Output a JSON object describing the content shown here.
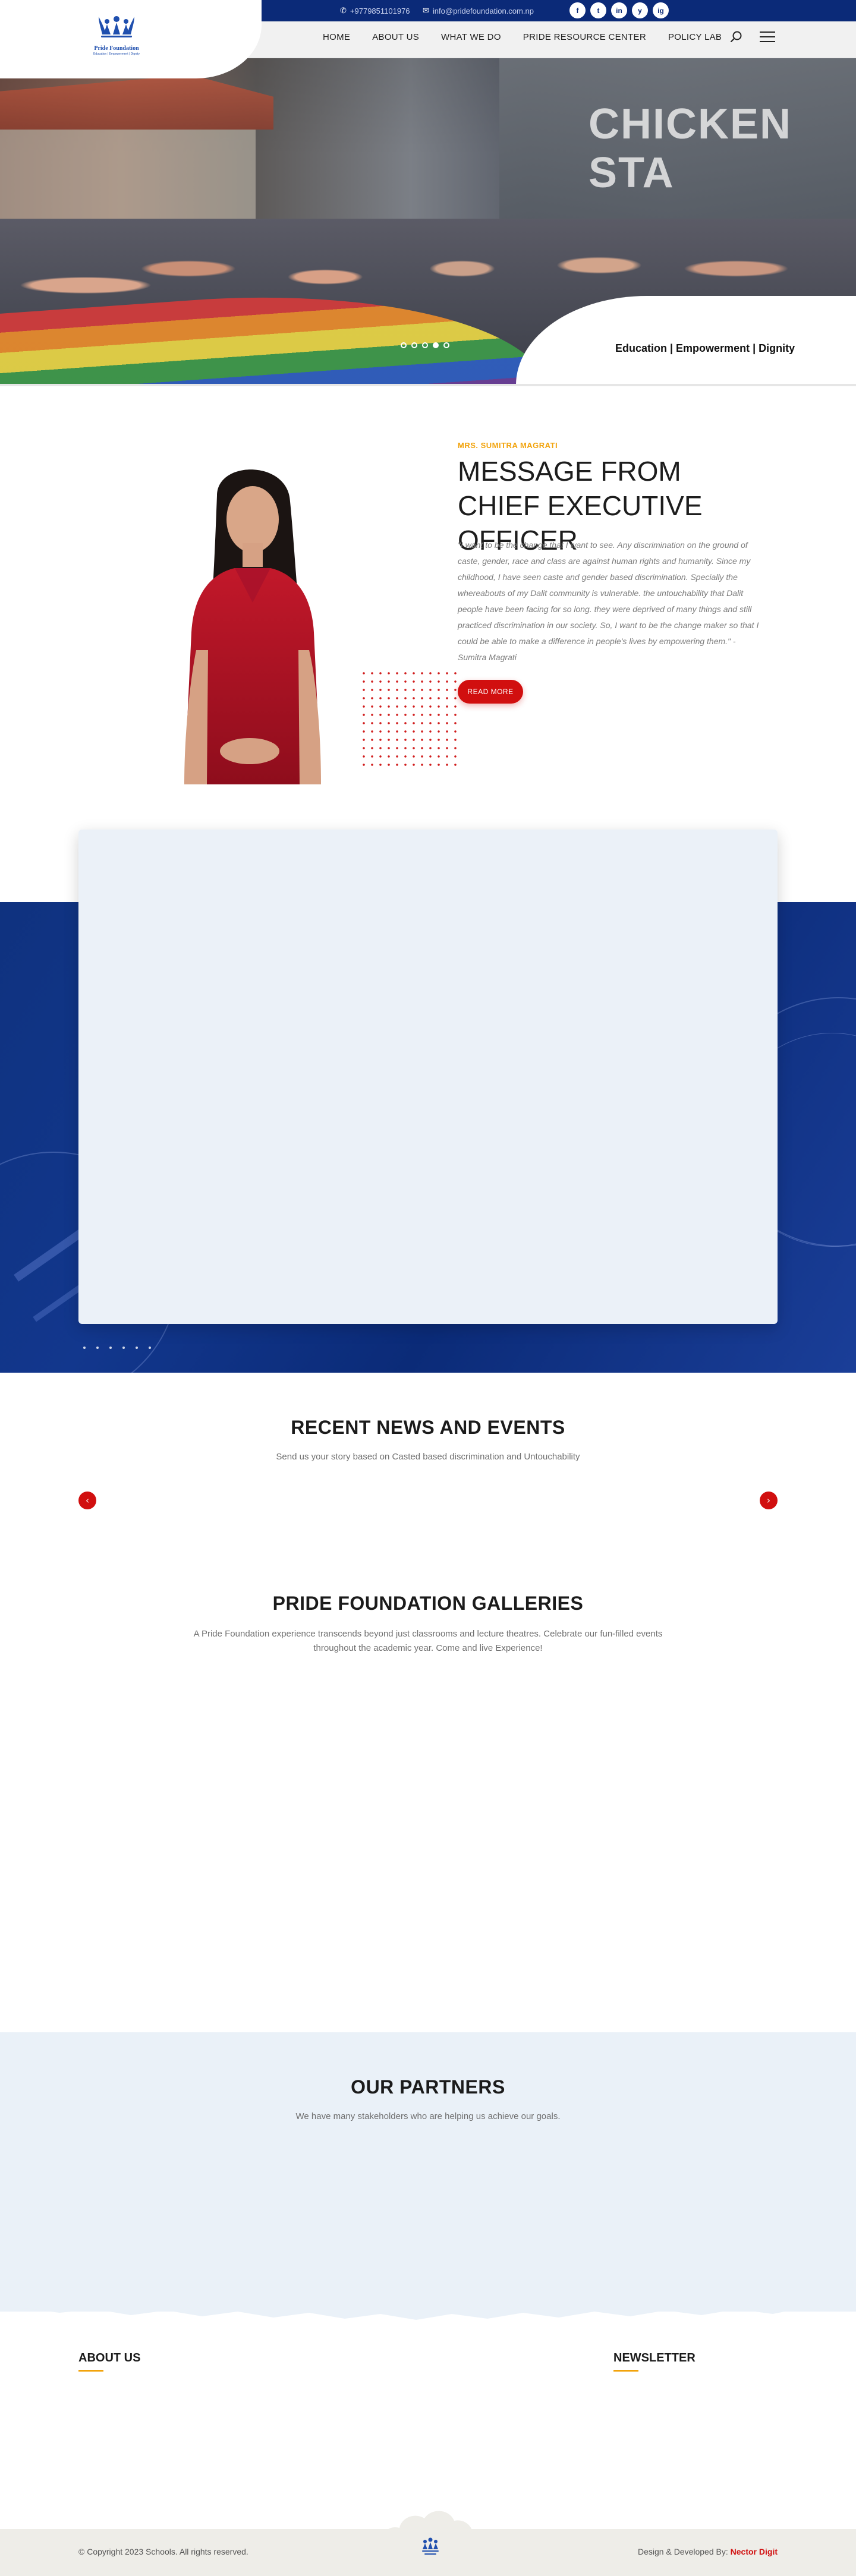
{
  "header": {
    "phone": "+9779851101976",
    "email": "info@pridefoundation.com.np",
    "logo": {
      "name": "Pride Foundation",
      "tagline": "Education | Empowerment | Dignity"
    },
    "social": [
      "f",
      "t",
      "in",
      "y",
      "ig"
    ],
    "nav": [
      "HOME",
      "ABOUT US",
      "WHAT WE DO",
      "PRIDE RESOURCE CENTER",
      "POLICY LAB"
    ]
  },
  "hero": {
    "sign_text": "CHICKEN STA",
    "tagline": "Education | Empowerment | Dignity",
    "slides": 5,
    "active_slide": 4
  },
  "ceo": {
    "kicker": "MRS. SUMITRA MAGRATI",
    "title": "MESSAGE FROM CHIEF EXECUTIVE OFFICER",
    "quote": "\"I want to be the change that I want to see. Any discrimination on the ground of caste,  gender, race and class are against human rights and humanity. Since my childhood, I have  seen caste and gender based discrimination. Specially the whereabouts of my Dalit  community is vulnerable. the untouchability that Dalit people have been facing for so long.  they were deprived of many things and still practiced discrimination in our society. So, I  want to be the change maker so that I could be able to make a difference in people's lives  by empowering them.\" - Sumitra Magrati",
    "button": "READ MORE"
  },
  "news": {
    "title": "RECENT NEWS AND EVENTS",
    "subtitle": "Send us your story based on Casted based discrimination and Untouchability",
    "prev": "‹",
    "next": "›"
  },
  "galleries": {
    "title": "PRIDE FOUNDATION GALLERIES",
    "subtitle_1": "A Pride Foundation experience transcends beyond just classrooms and lecture theatres. Celebrate our fun-filled events",
    "subtitle_2": "throughout the academic year. Come and live Experience!"
  },
  "partners": {
    "title": "OUR PARTNERS",
    "subtitle": "We have many stakeholders who are helping us achieve our goals."
  },
  "footer": {
    "about_heading": "ABOUT US",
    "newsletter_heading": "NEWSLETTER",
    "copyright": "© Copyright 2023 Schools. All rights reserved.",
    "credit_prefix": "Design & Developed By:",
    "credit_company": "Nector Digit"
  },
  "colors": {
    "brand_blue": "#0b2a78",
    "accent_red": "#d10f0f",
    "accent_orange": "#f2a30c",
    "light_panel": "#ebf1f8"
  }
}
